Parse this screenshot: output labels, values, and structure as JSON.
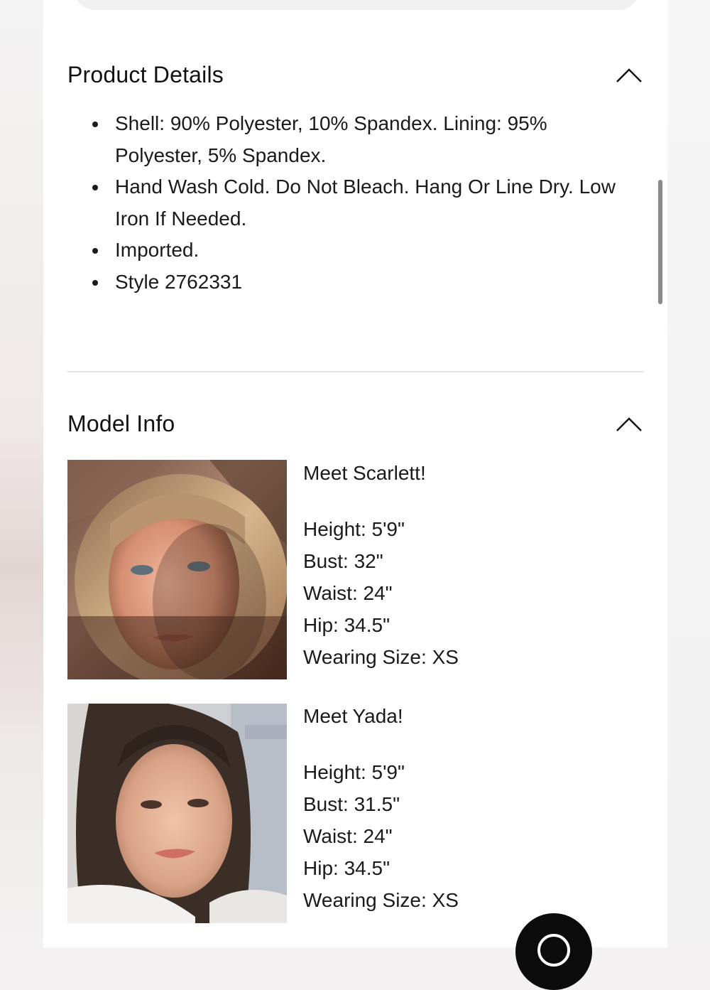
{
  "product_details": {
    "title": "Product Details",
    "items": [
      "Shell: 90% Polyester, 10% Spandex. Lining: 95% Polyester, 5% Spandex.",
      "Hand Wash Cold. Do Not Bleach. Hang Or Line Dry. Low Iron If Needed.",
      "Imported.",
      "Style 2762331"
    ]
  },
  "model_info": {
    "title": "Model Info",
    "models": [
      {
        "intro": "Meet Scarlett!",
        "height": "Height: 5'9\"",
        "bust": "Bust: 32\"",
        "waist": "Waist: 24\"",
        "hip": "Hip: 34.5\"",
        "size": "Wearing Size: XS"
      },
      {
        "intro": "Meet Yada!",
        "height": "Height: 5'9\"",
        "bust": "Bust: 31.5\"",
        "waist": "Waist: 24\"",
        "hip": "Hip: 34.5\"",
        "size": "Wearing Size: XS"
      }
    ]
  },
  "icons": {
    "collapse": "chevron-up-icon",
    "chat": "chat-icon"
  },
  "colors": {
    "text": "#111111",
    "chat_button": "#0b0b0b",
    "divider": "#e6e6e6"
  }
}
